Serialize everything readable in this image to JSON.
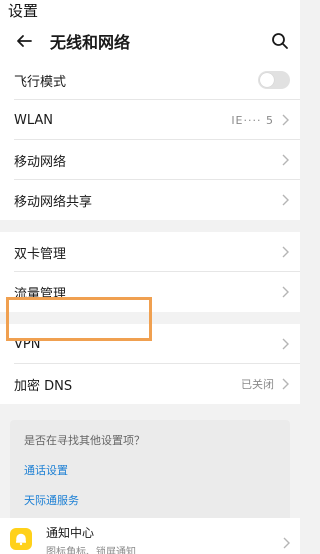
{
  "status": {
    "title": "设置"
  },
  "header": {
    "title": "无线和网络"
  },
  "section1": [
    {
      "label": "飞行模式",
      "type": "toggle",
      "on": false
    },
    {
      "label": "WLAN",
      "type": "value",
      "value": "IE···· 5"
    },
    {
      "label": "移动网络",
      "type": "chevron"
    },
    {
      "label": "移动网络共享",
      "type": "chevron"
    }
  ],
  "section2": [
    {
      "label": "双卡管理"
    },
    {
      "label": "流量管理"
    }
  ],
  "section3": [
    {
      "label": "VPN"
    },
    {
      "label": "加密 DNS",
      "value": "已关闭"
    }
  ],
  "suggest": {
    "question": "是否在寻找其他设置项？",
    "links": [
      "通话设置",
      "天际通服务"
    ]
  },
  "notification": {
    "title": "通知中心",
    "subtitle": "图标角标、锁屏通知"
  },
  "colors": {
    "accent": "#1b7fd4",
    "highlight": "#f0a050",
    "bell": "#ffd11a"
  }
}
